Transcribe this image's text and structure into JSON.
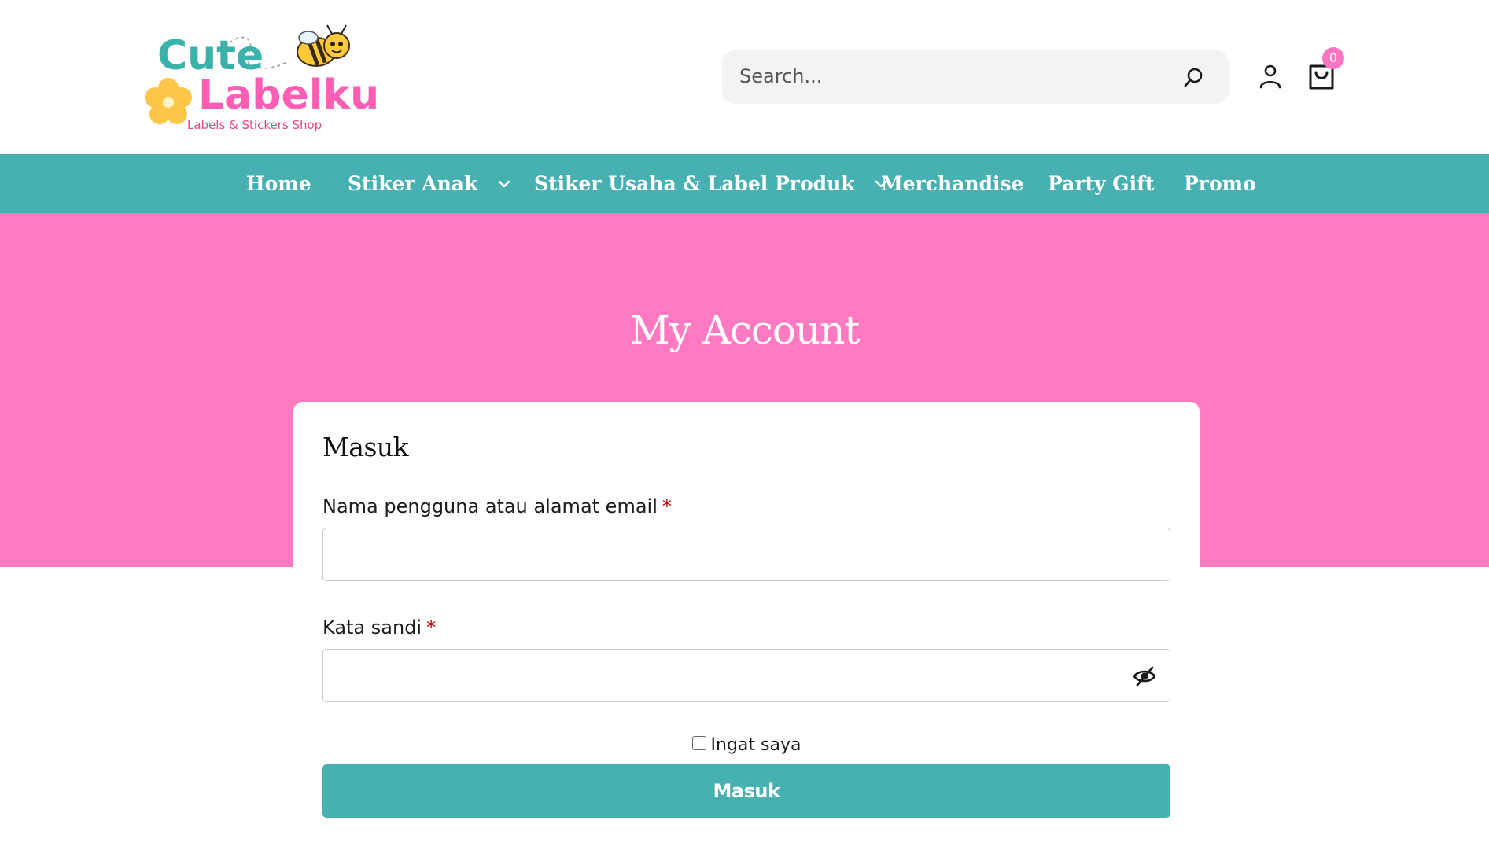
{
  "header": {
    "logo": {
      "line1": "Cute",
      "line2": "Labelku",
      "tagline": "Labels & Stickers Shop"
    },
    "search": {
      "placeholder": "Search..."
    },
    "cart_count": "0"
  },
  "nav": {
    "items": [
      {
        "label": "Home",
        "has_dropdown": false
      },
      {
        "label": "Stiker Anak",
        "has_dropdown": true
      },
      {
        "label": "Stiker Usaha & Label Produk",
        "has_dropdown": true
      },
      {
        "label": "Merchandise",
        "has_dropdown": false
      },
      {
        "label": "Party Gift",
        "has_dropdown": false
      },
      {
        "label": "Promo",
        "has_dropdown": false
      }
    ]
  },
  "hero": {
    "title": "My Account"
  },
  "login": {
    "title": "Masuk",
    "username_label": "Nama pengguna atau alamat email",
    "password_label": "Kata sandi",
    "required_mark": "*",
    "remember_label": "Ingat saya",
    "submit_label": "Masuk"
  },
  "colors": {
    "teal": "#46b1b0",
    "pink": "#ff7ac1",
    "badge": "#ff77c0",
    "required": "#b00000"
  }
}
